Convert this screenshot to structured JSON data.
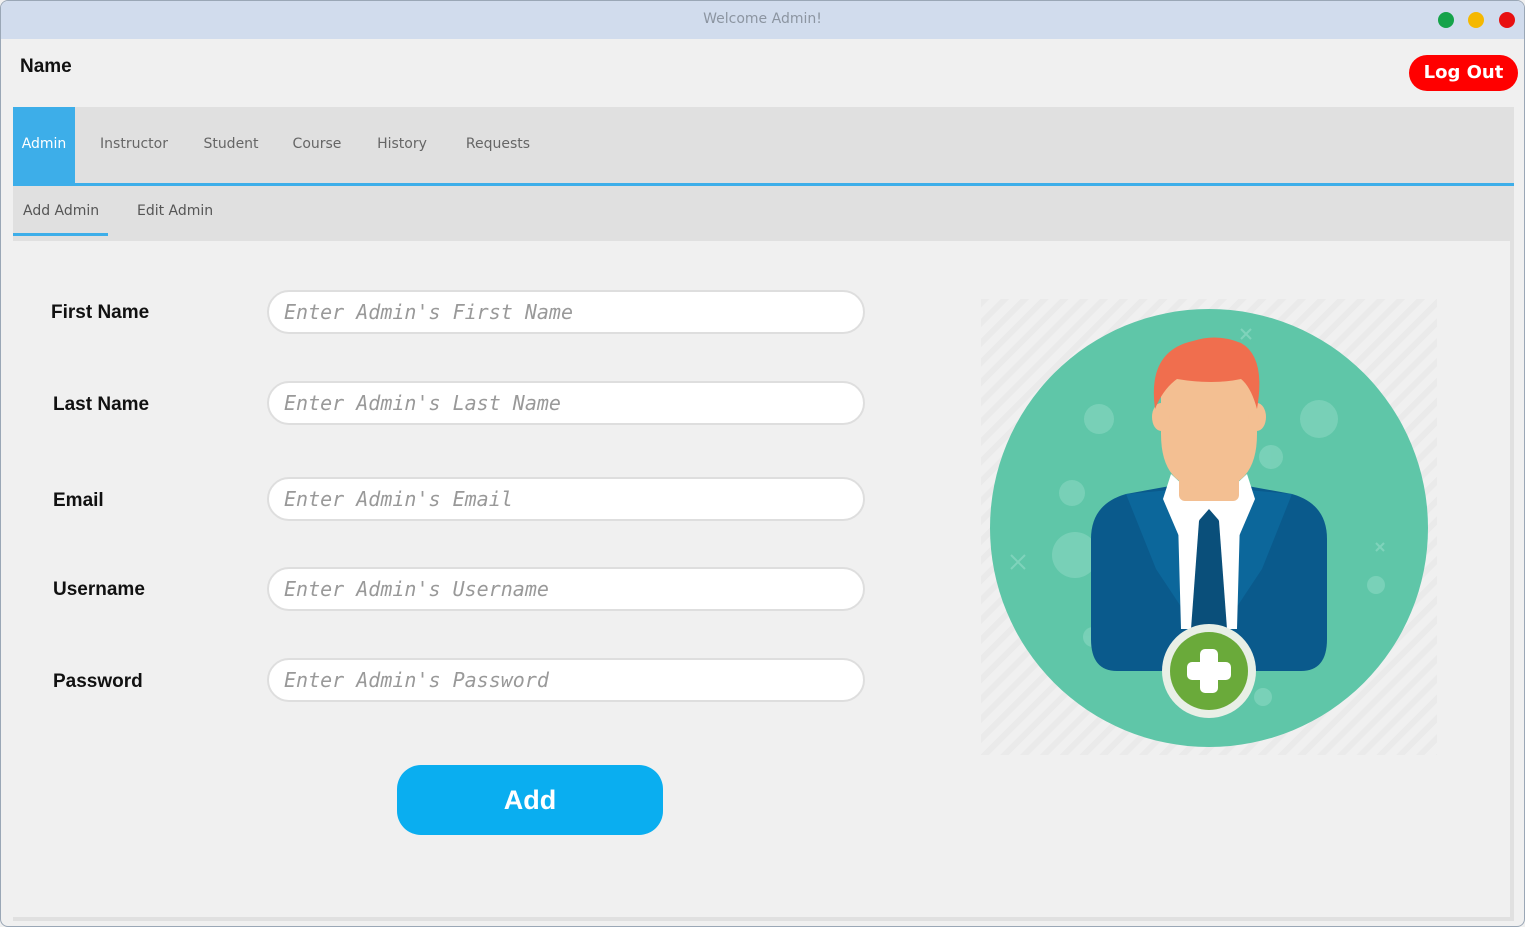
{
  "window": {
    "title": "Welcome Admin!",
    "controls": {
      "minimize_color": "#15a34a",
      "maximize_color": "#f5b800",
      "close_color": "#e81010"
    }
  },
  "header": {
    "user_name": "Name",
    "logout_label": "Log Out",
    "logout_color": "#ff0000"
  },
  "tabs": [
    {
      "label": "Admin",
      "active": true
    },
    {
      "label": "Instructor",
      "active": false
    },
    {
      "label": "Student",
      "active": false
    },
    {
      "label": "Course",
      "active": false
    },
    {
      "label": "History",
      "active": false
    },
    {
      "label": "Requests",
      "active": false
    }
  ],
  "subtabs": [
    {
      "label": "Add Admin",
      "active": true
    },
    {
      "label": "Edit Admin",
      "active": false
    }
  ],
  "form": {
    "fields": [
      {
        "label": "First Name",
        "placeholder": "Enter Admin's First Name",
        "value": ""
      },
      {
        "label": "Last Name",
        "placeholder": "Enter Admin's Last Name",
        "value": ""
      },
      {
        "label": "Email",
        "placeholder": "Enter Admin's Email",
        "value": ""
      },
      {
        "label": "Username",
        "placeholder": "Enter Admin's Username",
        "value": ""
      },
      {
        "label": "Password",
        "placeholder": "Enter Admin's Password",
        "value": ""
      }
    ],
    "submit_label": "Add"
  },
  "colors": {
    "accent": "#3daee9",
    "add_button": "#0aaef0",
    "illustration_bg": "#5fc6a8",
    "suit": "#0a5a8c",
    "hair": "#f06e4e",
    "skin": "#f3bf92",
    "plus_badge": "#6aaa3a"
  },
  "illustration_icon": "add-user-icon"
}
